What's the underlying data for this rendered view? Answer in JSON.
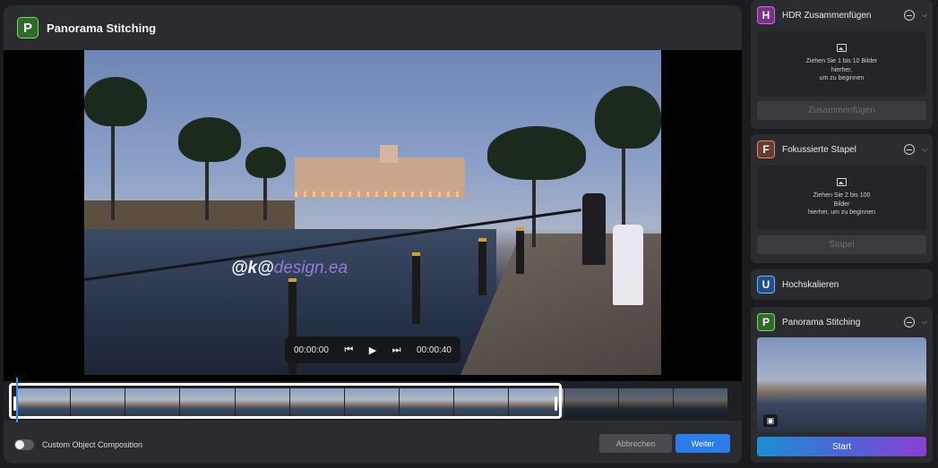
{
  "dialog": {
    "title": "Panorama Stitching",
    "icon": "P",
    "player": {
      "current_time": "00:00:00",
      "total_time": "00:00:40"
    },
    "watermark": {
      "prefix": "@k@",
      "suffix": "design.ea"
    },
    "footer": {
      "toggle_label": "Custom Object Composition",
      "cancel_label": "Abbrechen",
      "next_label": "Weiter"
    }
  },
  "sidebar": {
    "hdr": {
      "icon": "H",
      "title": "HDR Zusammenfügen",
      "drop_text_1": "Ziehen Sie 1 bis 10 Bilder",
      "drop_text_2": "hierher,",
      "drop_text_3": "um zu beginnen",
      "button": "Zusammenfügen"
    },
    "focus": {
      "icon": "F",
      "title": "Fokussierte Stapel",
      "drop_text_1": "Ziehen Sie 2 bis 100",
      "drop_text_2": "Bilder",
      "drop_text_3": "hierher, um zu beginnen",
      "button": "Stapel"
    },
    "upscale": {
      "icon": "U",
      "title": "Hochskalieren"
    },
    "panorama": {
      "icon": "P",
      "title": "Panorama Stitching",
      "start": "Start"
    }
  },
  "colors": {
    "accent_blue": "#2b7de9",
    "panorama_green": "#2f6a2d",
    "hdr_purple": "#7a2f8f",
    "focus_brown": "#6b3b2b",
    "upscale_blue": "#1d4f8a"
  }
}
